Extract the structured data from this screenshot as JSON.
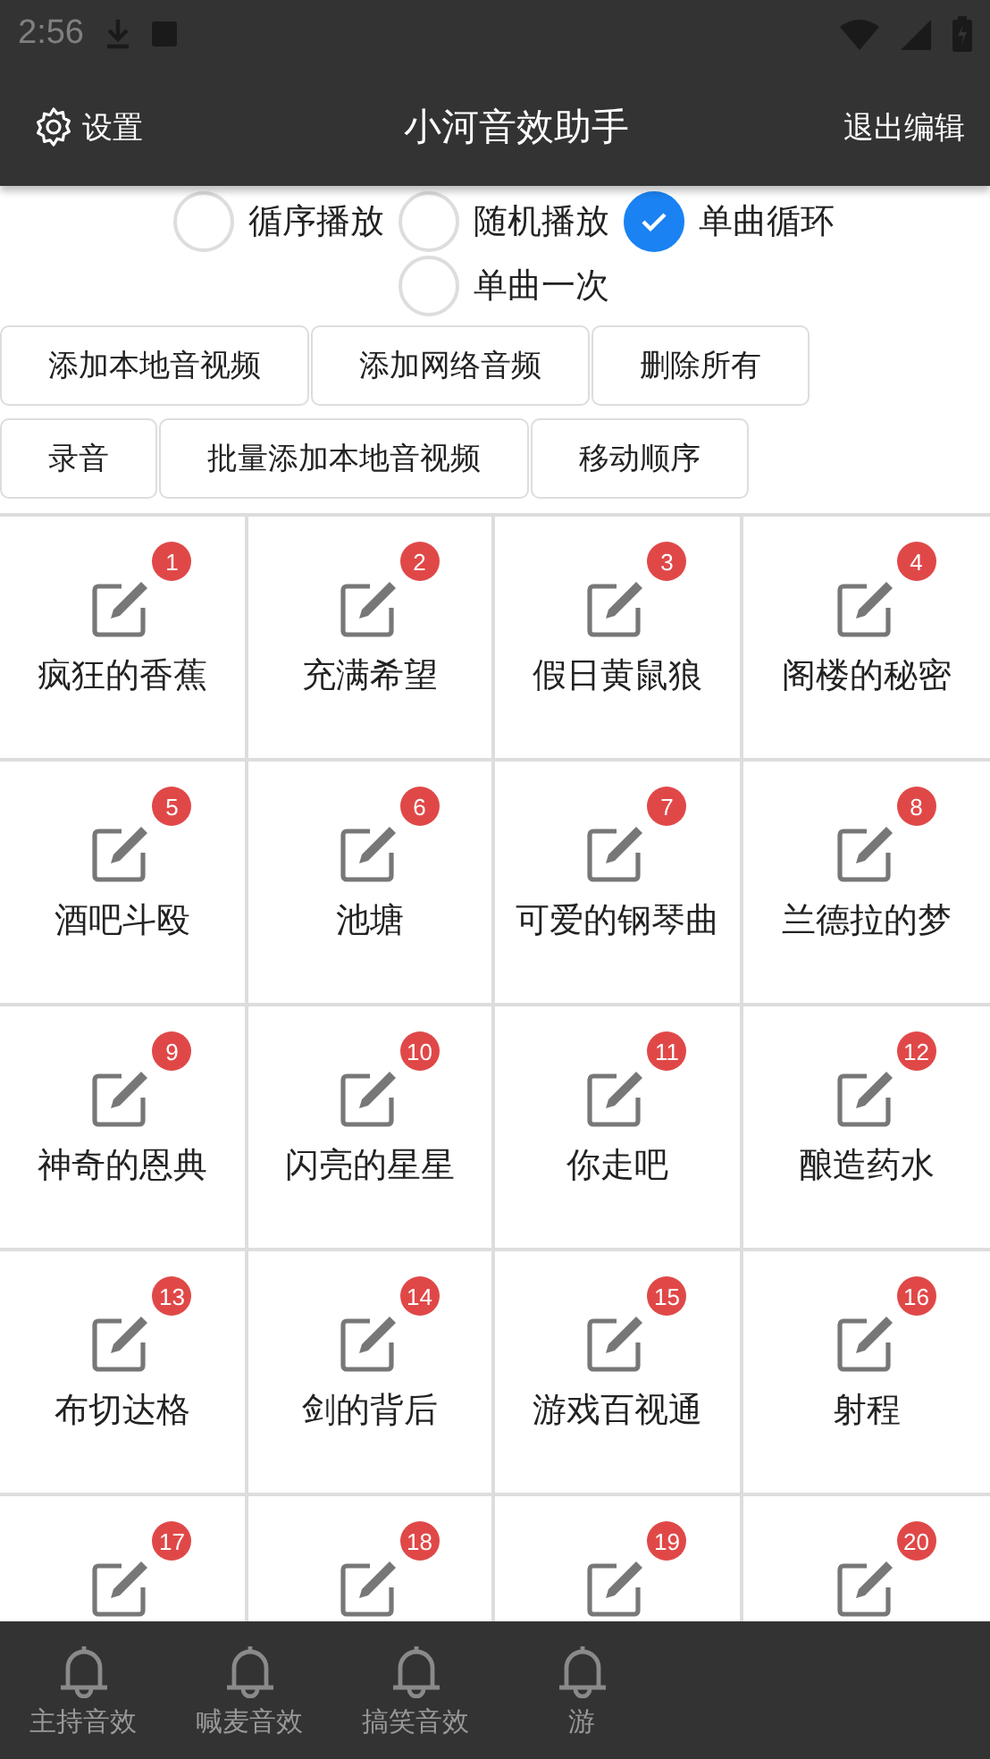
{
  "status_bar": {
    "time": "2:56"
  },
  "toolbar": {
    "settings": "设置",
    "title": "小河音效助手",
    "action": "退出编辑"
  },
  "play_modes": [
    {
      "label": "循序播放",
      "selected": false
    },
    {
      "label": "随机播放",
      "selected": false
    },
    {
      "label": "单曲循环",
      "selected": true
    },
    {
      "label": "单曲一次",
      "selected": false
    }
  ],
  "button_rows": [
    [
      "添加本地音视频",
      "添加网络音频",
      "删除所有"
    ],
    [
      "录音",
      "批量添加本地音视频",
      "移动顺序"
    ]
  ],
  "sounds": [
    {
      "badge": "1",
      "label": "疯狂的香蕉"
    },
    {
      "badge": "2",
      "label": "充满希望"
    },
    {
      "badge": "3",
      "label": "假日黄鼠狼"
    },
    {
      "badge": "4",
      "label": "阁楼的秘密"
    },
    {
      "badge": "5",
      "label": "酒吧斗殴"
    },
    {
      "badge": "6",
      "label": "池塘"
    },
    {
      "badge": "7",
      "label": "可爱的钢琴曲"
    },
    {
      "badge": "8",
      "label": "兰德拉的梦"
    },
    {
      "badge": "9",
      "label": "神奇的恩典"
    },
    {
      "badge": "10",
      "label": "闪亮的星星"
    },
    {
      "badge": "11",
      "label": "你走吧"
    },
    {
      "badge": "12",
      "label": "酿造药水"
    },
    {
      "badge": "13",
      "label": "布切达格"
    },
    {
      "badge": "14",
      "label": "剑的背后"
    },
    {
      "badge": "15",
      "label": "游戏百视通"
    },
    {
      "badge": "16",
      "label": "射程"
    },
    {
      "badge": "17"
    },
    {
      "badge": "18"
    },
    {
      "badge": "19"
    },
    {
      "badge": "20"
    }
  ],
  "bottom_nav": [
    {
      "label": "主持音效"
    },
    {
      "label": "喊麦音效"
    },
    {
      "label": "搞笑音效"
    },
    {
      "label": "游"
    }
  ]
}
